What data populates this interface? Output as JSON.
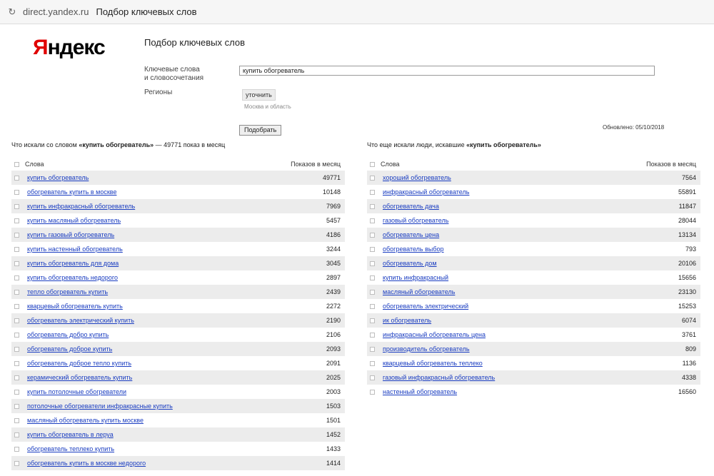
{
  "browser": {
    "domain": "direct.yandex.ru",
    "page_title": "Подбор ключевых слов"
  },
  "logo": {
    "first": "Я",
    "rest": "ндекс"
  },
  "form": {
    "title": "Подбор ключевых слов",
    "keywords_label_line1": "Ключевые слова",
    "keywords_label_line2": "и словосочетания",
    "keywords_value": "купить обогреватель",
    "regions_label": "Регионы",
    "refine_label": "уточнить",
    "region_value": "Москва и область",
    "submit_label": "Подобрать",
    "updated_text": "Обновлено: 05/10/2018"
  },
  "left": {
    "title_prefix": "Что искали со словом",
    "title_bold": "«купить обогреватель»",
    "title_suffix": "— 49771 показ в месяц",
    "col_word": "Слова",
    "col_count": "Показов в месяц",
    "rows": [
      {
        "word": "купить обогреватель",
        "count": "49771"
      },
      {
        "word": "обогреватель купить в москве",
        "count": "10148"
      },
      {
        "word": "купить инфракрасный обогреватель",
        "count": "7969"
      },
      {
        "word": "купить масляный обогреватель",
        "count": "5457"
      },
      {
        "word": "купить газовый обогреватель",
        "count": "4186"
      },
      {
        "word": "купить настенный обогреватель",
        "count": "3244"
      },
      {
        "word": "купить обогреватель для дома",
        "count": "3045"
      },
      {
        "word": "купить обогреватель недорого",
        "count": "2897"
      },
      {
        "word": "тепло обогреватель купить",
        "count": "2439"
      },
      {
        "word": "кварцевый обогреватель купить",
        "count": "2272"
      },
      {
        "word": "обогреватель электрический купить",
        "count": "2190"
      },
      {
        "word": "обогреватель добро купить",
        "count": "2106"
      },
      {
        "word": "обогреватель доброе купить",
        "count": "2093"
      },
      {
        "word": "обогреватель доброе тепло купить",
        "count": "2091"
      },
      {
        "word": "керамический обогреватель купить",
        "count": "2025"
      },
      {
        "word": "купить потолочные обогреватели",
        "count": "2003"
      },
      {
        "word": "потолочные обогреватели инфракрасные купить",
        "count": "1503"
      },
      {
        "word": "масляный обогреватель купить москве",
        "count": "1501"
      },
      {
        "word": "купить обогреватель в леруа",
        "count": "1452"
      },
      {
        "word": "обогреватель теплеко купить",
        "count": "1433"
      },
      {
        "word": "обогреватель купить в москве недорого",
        "count": "1414"
      }
    ]
  },
  "right": {
    "title_prefix": "Что еще искали люди, искавшие",
    "title_bold": "«купить обогреватель»",
    "col_word": "Слова",
    "col_count": "Показов в месяц",
    "rows": [
      {
        "word": "хороший обогреватель",
        "count": "7564"
      },
      {
        "word": "инфракрасный обогреватель",
        "count": "55891"
      },
      {
        "word": "обогреватель дача",
        "count": "11847"
      },
      {
        "word": "газовый обогреватель",
        "count": "28044"
      },
      {
        "word": "обогреватель цена",
        "count": "13134"
      },
      {
        "word": "обогреватель выбор",
        "count": "793"
      },
      {
        "word": "обогреватель дом",
        "count": "20106"
      },
      {
        "word": "купить инфракрасный",
        "count": "15656"
      },
      {
        "word": "масляный обогреватель",
        "count": "23130"
      },
      {
        "word": "обогреватель электрический",
        "count": "15253"
      },
      {
        "word": "ик обогреватель",
        "count": "6074"
      },
      {
        "word": "инфракрасный обогреватель цена",
        "count": "3761"
      },
      {
        "word": "производитель обогреватель",
        "count": "809"
      },
      {
        "word": "кварцевый обогреватель теплеко",
        "count": "1136"
      },
      {
        "word": "газовый инфракрасный обогреватель",
        "count": "4338"
      },
      {
        "word": "настенный обогреватель",
        "count": "16560"
      }
    ]
  },
  "colors": {
    "link": "#1a3dc1",
    "stripe": "#ececec",
    "logo_red": "#e00000"
  }
}
